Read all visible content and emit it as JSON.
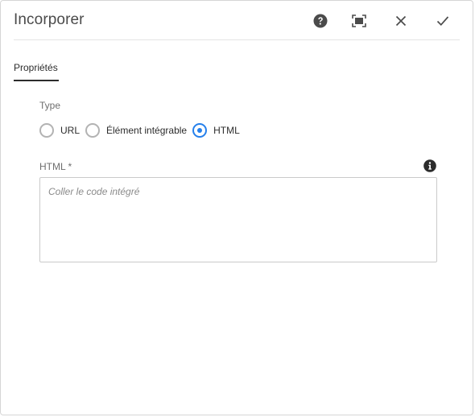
{
  "dialog": {
    "title": "Incorporer",
    "actions": {
      "help_icon": "help-circle-icon",
      "fullscreen_icon": "fullscreen-icon",
      "close_icon": "close-icon",
      "confirm_icon": "checkmark-icon"
    }
  },
  "tabs": [
    {
      "label": "Propriétés",
      "selected": true
    }
  ],
  "type_field": {
    "label": "Type",
    "options": [
      {
        "label": "URL",
        "checked": false
      },
      {
        "label": "Élément intégrable",
        "checked": false
      },
      {
        "label": "HTML",
        "checked": true
      }
    ]
  },
  "html_field": {
    "label": "HTML *",
    "value": "",
    "placeholder": "Coller le code intégré",
    "info_icon": "info-icon"
  },
  "colors": {
    "accent": "#2680eb",
    "text": "#2c2c2c",
    "border": "#cacaca"
  }
}
